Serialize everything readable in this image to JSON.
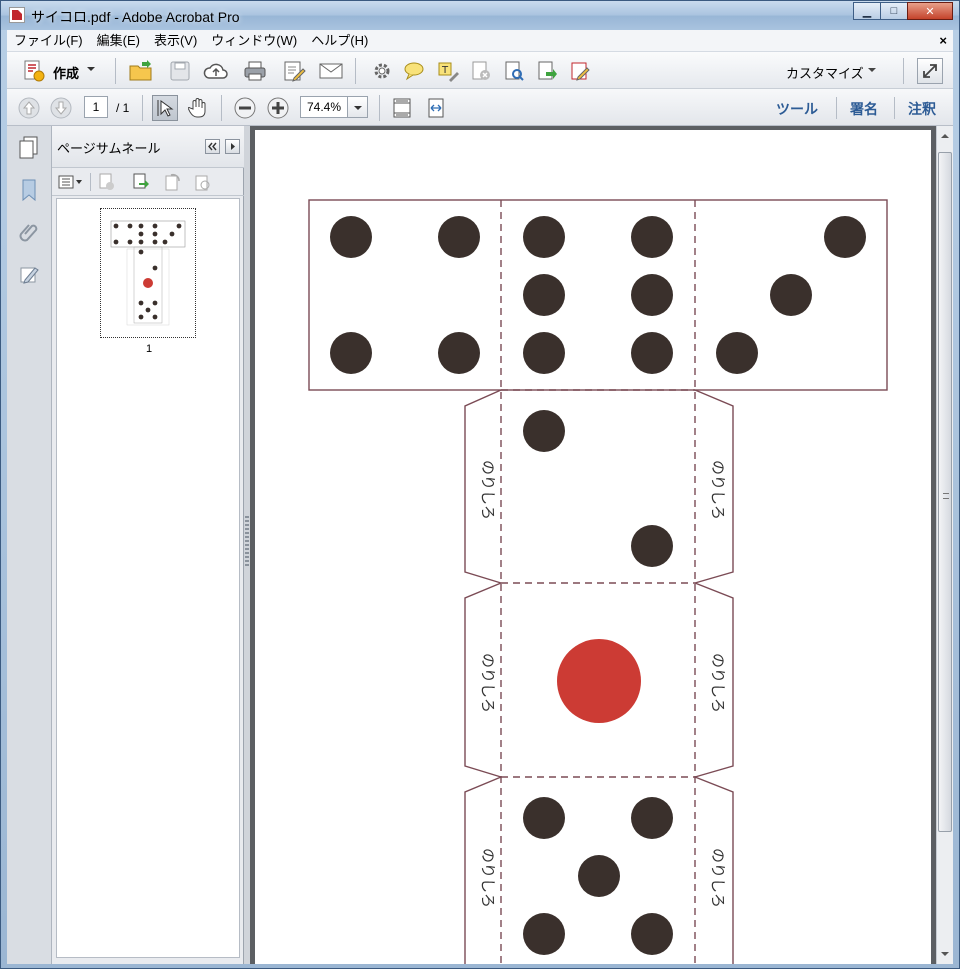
{
  "window": {
    "title": "サイコロ.pdf - Adobe Acrobat Pro",
    "minimize": "▁",
    "maximize": "□",
    "close": "✕"
  },
  "menu": {
    "items": [
      "ファイル(F)",
      "編集(E)",
      "表示(V)",
      "ウィンドウ(W)",
      "ヘルプ(H)"
    ],
    "close_doc": "×"
  },
  "toolbar": {
    "create_label": "作成",
    "customize_label": "カスタマイズ"
  },
  "navigation": {
    "current_page": "1",
    "total_pages": "/ 1",
    "zoom": "74.4%"
  },
  "right_links": {
    "tools": "ツール",
    "sign": "署名",
    "comment": "注釈"
  },
  "thumbnail_panel": {
    "title": "ページサムネール",
    "page_number": "1"
  },
  "document": {
    "glue_tab_label": "のりしろ",
    "pip_color": "#3a302c",
    "red_pip_color": "#cc3b34",
    "cut_line_color": "#7b4b55"
  }
}
